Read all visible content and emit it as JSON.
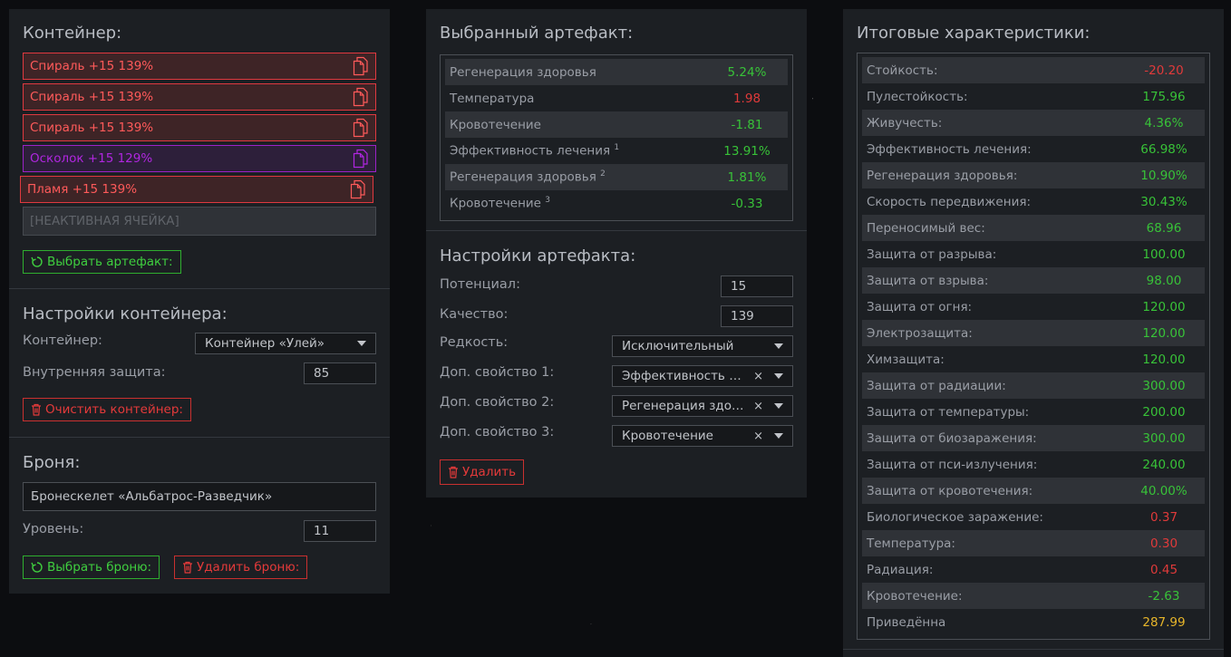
{
  "container_panel": {
    "title": "Контейнер:",
    "slots": [
      {
        "label": "Спираль +15 139%",
        "style": "red"
      },
      {
        "label": "Спираль +15 139%",
        "style": "red"
      },
      {
        "label": "Спираль +15 139%",
        "style": "red"
      },
      {
        "label": "Осколок +15 129%",
        "style": "purple"
      },
      {
        "label": "Пламя +15 139%",
        "style": "red"
      },
      {
        "label": "[НЕАКТИВНАЯ ЯЧЕЙКА]",
        "style": "inactive"
      }
    ],
    "select_artifact_label": "Выбрать артефакт:",
    "settings_title": "Настройки контейнера:",
    "container_label": "Контейнер:",
    "container_value": "Контейнер «Улей»",
    "inner_protection_label": "Внутренняя защита:",
    "inner_protection_value": "85",
    "clear_container_label": "Очистить контейнер:",
    "armor_title": "Броня:",
    "armor_value": "Бронескелет «Альбатрос-Разведчик»",
    "level_label": "Уровень:",
    "level_value": "11",
    "select_armor_label": "Выбрать броню:",
    "delete_armor_label": "Удалить броню:"
  },
  "artifact_panel": {
    "title": "Выбранный артефакт:",
    "stats": [
      {
        "name": "Регенерация здоровья",
        "sup": "",
        "value": "5.24%",
        "color": "green"
      },
      {
        "name": "Температура",
        "sup": "",
        "value": "1.98",
        "color": "red"
      },
      {
        "name": "Кровотечение",
        "sup": "",
        "value": "-1.81",
        "color": "green"
      },
      {
        "name": "Эффективность лечения",
        "sup": "1",
        "value": "13.91%",
        "color": "green"
      },
      {
        "name": "Регенерация здоровья",
        "sup": "2",
        "value": "1.81%",
        "color": "green"
      },
      {
        "name": "Кровотечение",
        "sup": "3",
        "value": "-0.33",
        "color": "green"
      }
    ],
    "settings_title": "Настройки артефакта:",
    "potential_label": "Потенциал:",
    "potential_value": "15",
    "quality_label": "Качество:",
    "quality_value": "139",
    "rarity_label": "Редкость:",
    "rarity_value": "Исключительный",
    "prop1_label": "Доп. свойство 1:",
    "prop1_value": "Эффективность лечения",
    "prop2_label": "Доп. свойство 2:",
    "prop2_value": "Регенерация здоровья",
    "prop3_label": "Доп. свойство 3:",
    "prop3_value": "Кровотечение",
    "clear_glyph": "×",
    "delete_label": "Удалить"
  },
  "totals_panel": {
    "title": "Итоговые характеристики:",
    "stats": [
      {
        "name": "Стойкость:",
        "value": "-20.20",
        "color": "red"
      },
      {
        "name": "Пулестойкость:",
        "value": "175.96",
        "color": "green"
      },
      {
        "name": "Живучесть:",
        "value": "4.36%",
        "color": "green"
      },
      {
        "name": "Эффективность лечения:",
        "value": "66.98%",
        "color": "green"
      },
      {
        "name": "Регенерация здоровья:",
        "value": "10.90%",
        "color": "green"
      },
      {
        "name": "Скорость передвижения:",
        "value": "30.43%",
        "color": "green"
      },
      {
        "name": "Переносимый вес:",
        "value": "68.96",
        "color": "green"
      },
      {
        "name": "Защита от разрыва:",
        "value": "100.00",
        "color": "green"
      },
      {
        "name": "Защита от взрыва:",
        "value": "98.00",
        "color": "green"
      },
      {
        "name": "Защита от огня:",
        "value": "120.00",
        "color": "green"
      },
      {
        "name": "Электрозащита:",
        "value": "120.00",
        "color": "green"
      },
      {
        "name": "Химзащита:",
        "value": "120.00",
        "color": "green"
      },
      {
        "name": "Защита от радиации:",
        "value": "300.00",
        "color": "green"
      },
      {
        "name": "Защита от температуры:",
        "value": "200.00",
        "color": "green"
      },
      {
        "name": "Защита от биозаражения:",
        "value": "300.00",
        "color": "green"
      },
      {
        "name": "Защита от пси-излучения:",
        "value": "240.00",
        "color": "green"
      },
      {
        "name": "Защита от кровотечения:",
        "value": "40.00%",
        "color": "green"
      },
      {
        "name": "Биологическое заражение:",
        "value": "0.37",
        "color": "red"
      },
      {
        "name": "Температура:",
        "value": "0.30",
        "color": "red"
      },
      {
        "name": "Радиация:",
        "value": "0.45",
        "color": "red"
      },
      {
        "name": "Кровотечение:",
        "value": "-2.63",
        "color": "green"
      },
      {
        "name": "Приведённа",
        "value": "287.99",
        "color": "gold"
      }
    ]
  }
}
